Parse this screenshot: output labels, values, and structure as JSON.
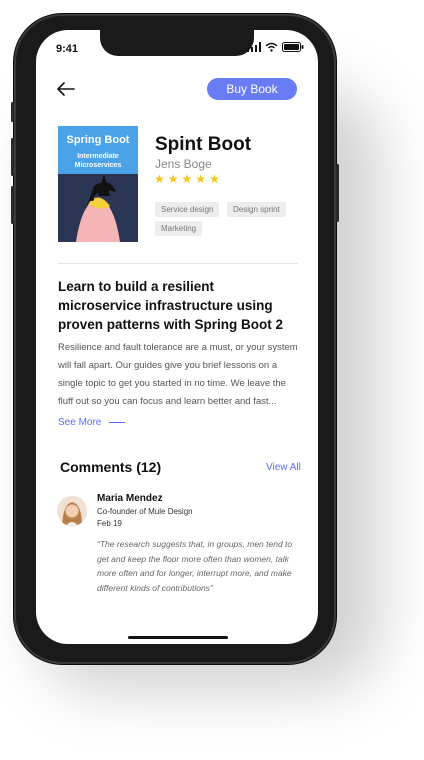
{
  "status": {
    "time": "9:41"
  },
  "header": {
    "buy_label": "Buy Book"
  },
  "book": {
    "cover_title": "Spring Boot",
    "cover_subtitle": "Intermediate Microservices",
    "title": "Spint Boot",
    "author": "Jens Boge",
    "rating": 5,
    "tags": [
      "Service design",
      "Design sprint",
      "Marketing"
    ]
  },
  "description": {
    "headline": "Learn to build a resilient microservice infrastructure using proven patterns with Spring Boot 2",
    "body": "Resilience and fault tolerance are a must, or your system will fall apart. Our guides give you brief lessons on a single topic to get you started in no time. We leave the fluff out so you can focus and learn better and fast...",
    "see_more": "See More"
  },
  "comments": {
    "title": "Comments (12)",
    "view_all": "View All",
    "items": [
      {
        "name": "Maria Mendez",
        "role": "Co-founder of Mule Design",
        "date": "Feb 19",
        "text": "“The research suggests that, in groups, men tend to get and keep the floor more often than women, talk more often and for longer, interrupt more, and make different kinds of contributions”"
      }
    ]
  },
  "colors": {
    "accent": "#6a7cf4",
    "link": "#5b6cf0",
    "star": "#f5c518",
    "cover_top": "#4aa3e8",
    "cover_bottom": "#2b3554"
  }
}
